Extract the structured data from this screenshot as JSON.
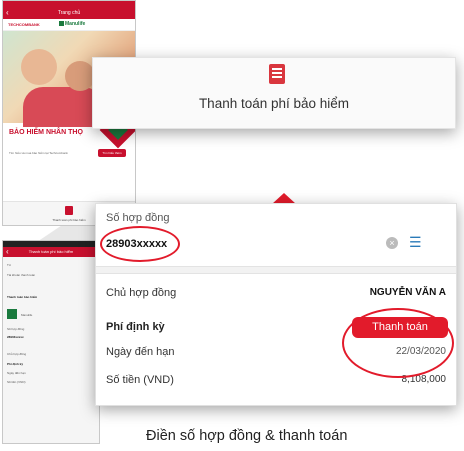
{
  "screen1": {
    "title": "Trang chủ",
    "bank_logo": "TECHCOMBANK",
    "insurer_logo": "Manulife",
    "banner_title": "BẢO HIỂM NHÂN THỌ",
    "banner_desc": "Tìm hiểu và mua bảo hiểm tại Techcombank",
    "cta": "Tìm hiểu thêm",
    "bottom_label": "Thanh toán phí bảo hiểm"
  },
  "screen2": {
    "title": "Thanh toán phí bảo hiểm",
    "lines": [
      "Từ",
      "Tài khoản thanh toán",
      "Thanh toán bảo hiểm",
      "Manulife",
      "Số hợp đồng",
      "28903xxxxx",
      "Chủ hợp đồng",
      "Phí định kỳ",
      "Ngày đến hạn",
      "Số tiền (VND)"
    ]
  },
  "callout1": {
    "caption": "Thanh toán phí bảo hiểm",
    "icon": "document-list-icon"
  },
  "callout2": {
    "field_label": "Số hợp đồng",
    "field_value": "28903xxxxx",
    "rows": {
      "owner_label": "Chủ hợp đồng",
      "owner_value": "NGUYỄN VĂN A",
      "fee_label": "Phí định kỳ",
      "pay_button": "Thanh toán",
      "due_label": "Ngày đến hạn",
      "due_value": "22/03/2020",
      "amount_label": "Số tiền (VND)",
      "amount_value": "8,108,000"
    }
  },
  "footer": "Điền số hợp đồng & thanh toán",
  "colors": {
    "brand_red": "#e21b2b",
    "manulife_green": "#1a7a3e"
  }
}
